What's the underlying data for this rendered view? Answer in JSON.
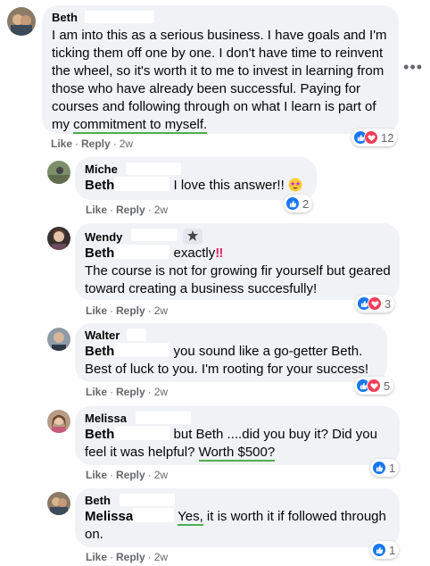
{
  "comments": [
    {
      "author": "Beth",
      "text": "I am into this as a serious business. I have goals and I'm ticking them off one by one. I don't have time to reinvent the wheel, so it's worth it to me to invest in learning from those who have already been successful. Paying for courses and following through on what I learn is part of my ",
      "underlined": "commitment to myself.",
      "like_label": "Like",
      "reply_label": "Reply",
      "time": "2w",
      "reaction_count": "12"
    }
  ],
  "replies": [
    {
      "author": "Miche",
      "mention": "Beth",
      "text": "I love this answer!!",
      "like_label": "Like",
      "reply_label": "Reply",
      "time": "2w",
      "reaction_count": "2"
    },
    {
      "author": "Wendy",
      "mention": "Beth",
      "text_first": "exactly",
      "text_rest": "The course is not for growing fir yourself but geared toward creating a business succesfully!",
      "like_label": "Like",
      "reply_label": "Reply",
      "time": "2w",
      "reaction_count": "3"
    },
    {
      "author": "Walter",
      "mention": "Beth",
      "text": "you sound like a go-getter Beth. Best of luck to you. I'm rooting for your success!",
      "like_label": "Like",
      "reply_label": "Reply",
      "time": "2w",
      "reaction_count": "5"
    },
    {
      "author": "Melissa",
      "mention": "Beth",
      "text": "but Beth ....did you buy it? Did you feel it was helpful? ",
      "underlined": "Worth $500?",
      "like_label": "Like",
      "reply_label": "Reply",
      "time": "2w",
      "reaction_count": "1"
    },
    {
      "author": "Beth",
      "mention": "Melissa",
      "underlined": "Yes,",
      "text": " it is worth it if followed through on.",
      "like_label": "Like",
      "reply_label": "Reply",
      "time": "2w",
      "reaction_count": "1"
    }
  ],
  "icons": {
    "like": "thumbs-up-icon",
    "love": "heart-icon",
    "more": "more-options-icon",
    "exclamation": "double-exclamation-emoji",
    "star_eyes": "star-struck-emoji",
    "badge": "top-fan-badge-icon"
  },
  "colors": {
    "bubble": "#f0f2f5",
    "like_blue": "#1877f2",
    "love_red": "#f33e58",
    "underline_green": "#4caf50",
    "meta_gray": "#65676b"
  }
}
